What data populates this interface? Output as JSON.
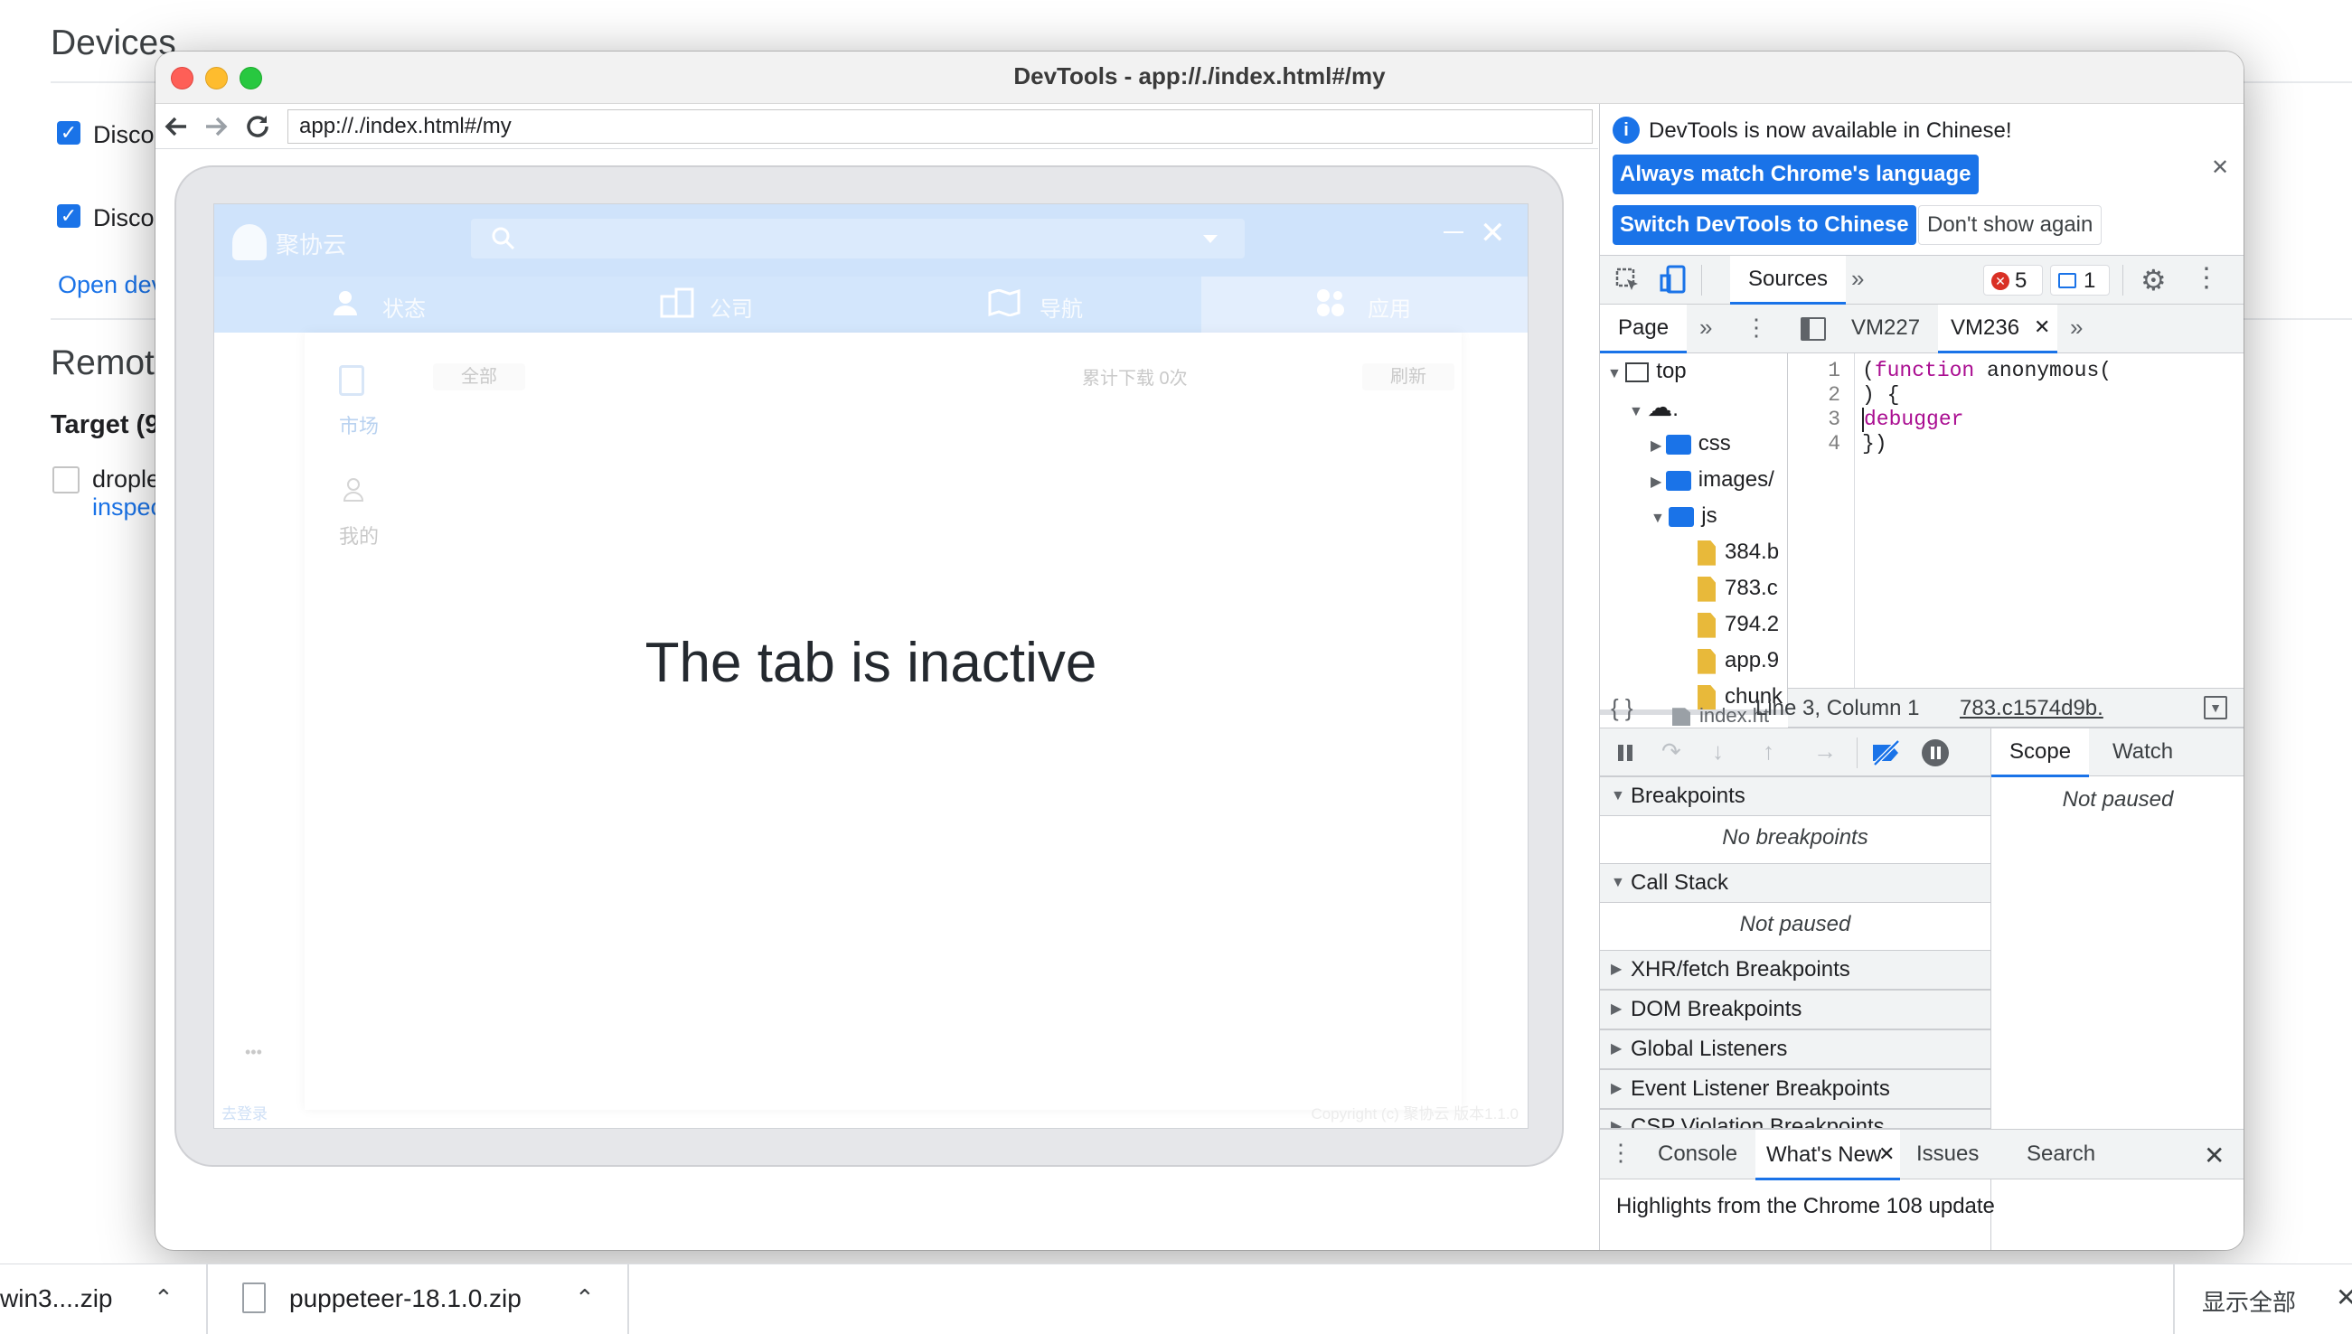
{
  "background": {
    "title": "Devices",
    "checkbox1_label": "Disco",
    "checkbox2_label": "Disco",
    "open_link": "Open dev",
    "remote_title": "Remote",
    "target_label": "Target (9",
    "target_item": "drople",
    "inspect_link": "inspec"
  },
  "window": {
    "title": "DevTools - app://./index.html#/my",
    "url": "app://./index.html#/my"
  },
  "app": {
    "logo_text": "聚协云",
    "tabs": [
      "状态",
      "公司",
      "导航",
      "应用"
    ],
    "side_items": [
      "市场",
      "我的"
    ],
    "filter_all": "全部",
    "download_count": "累计下载 0次",
    "refresh": "刷新",
    "more": "•••",
    "login": "去登录",
    "copyright": "Copyright (c) 聚协云 版本1.1.0",
    "overlay_message": "The tab is inactive"
  },
  "devtools": {
    "infobar_text": "DevTools is now available in Chinese!",
    "btn_match": "Always match Chrome's language",
    "btn_switch": "Switch DevTools to Chinese",
    "btn_dont_show": "Don't show again",
    "main_tab": "Sources",
    "error_count": "5",
    "message_count": "1",
    "nav_tab": "Page",
    "editor_tabs": [
      "VM227",
      "VM236"
    ],
    "tree": {
      "top": "top",
      "origin": ".",
      "folders": [
        "css",
        "images/",
        "js"
      ],
      "files": [
        "384.b",
        "783.c",
        "794.2",
        "app.9",
        "chunk"
      ],
      "index": "index.ht"
    },
    "code_lines": [
      {
        "num": "1",
        "text": "(function anonymous("
      },
      {
        "num": "2",
        "text": ") {"
      },
      {
        "num": "3",
        "text": "debugger"
      },
      {
        "num": "4",
        "text": "})"
      }
    ],
    "status_position": "Line 3, Column 1",
    "status_link": "783.c1574d9b.",
    "sections": {
      "breakpoints": "Breakpoints",
      "no_breakpoints": "No breakpoints",
      "call_stack": "Call Stack",
      "not_paused": "Not paused",
      "xhr": "XHR/fetch Breakpoints",
      "dom": "DOM Breakpoints",
      "global": "Global Listeners",
      "event": "Event Listener Breakpoints",
      "csp": "CSP Violation Breakpoints"
    },
    "scope_tab": "Scope",
    "watch_tab": "Watch",
    "scope_msg": "Not paused",
    "drawer_tabs": [
      "Console",
      "What's New",
      "Issues",
      "Search"
    ],
    "drawer_text": "Highlights from the Chrome 108 update"
  },
  "downloads": {
    "item1": "win3....zip",
    "item2": "puppeteer-18.1.0.zip",
    "show_all": "显示全部"
  }
}
